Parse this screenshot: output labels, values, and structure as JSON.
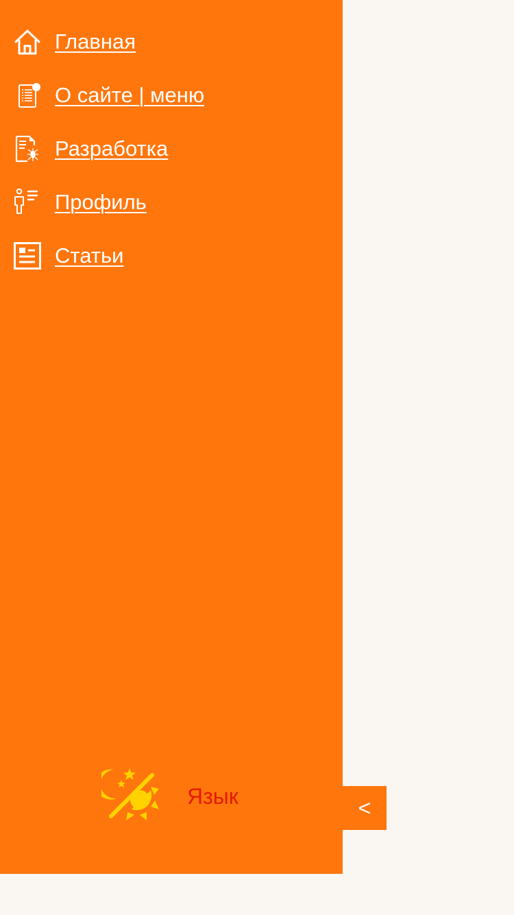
{
  "menu": {
    "items": [
      {
        "label": "Главная",
        "icon": "home-icon"
      },
      {
        "label": "О сайте | меню",
        "icon": "document-list-icon"
      },
      {
        "label": "Разработка",
        "icon": "document-bug-icon"
      },
      {
        "label": "Профиль",
        "icon": "user-profile-icon"
      },
      {
        "label": "Статьи",
        "icon": "newspaper-icon"
      }
    ]
  },
  "footer": {
    "theme_icon": "day-night-toggle-icon",
    "language_label": "Язык"
  },
  "drawer_toggle": {
    "label": "<"
  },
  "colors": {
    "drawer_bg": "#ff760d",
    "page_bg": "#faf6f2",
    "link_text": "#ffffff",
    "language_text": "#e31b00",
    "theme_icon": "#ffd200"
  }
}
